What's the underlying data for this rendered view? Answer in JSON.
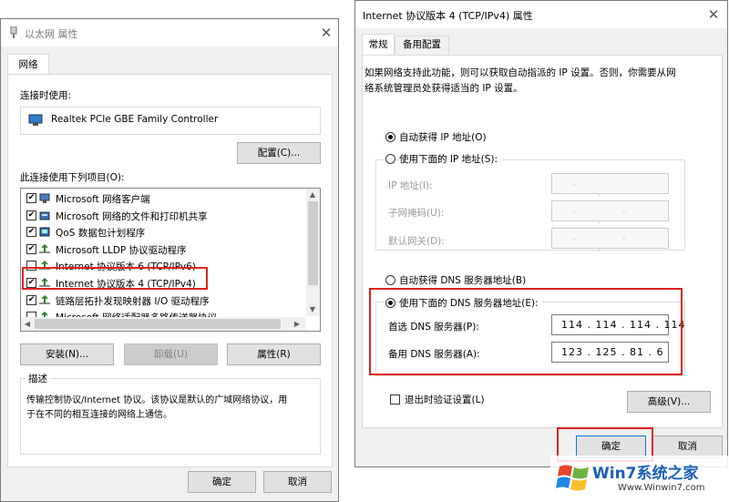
{
  "left_window": {
    "title": "以太网 属性",
    "tab": "网络",
    "connect_using_label": "连接时使用:",
    "adapter_name": "Realtek PCIe GBE Family Controller",
    "configure_button": "配置(C)...",
    "items_label": "此连接使用下列项目(O):",
    "items": [
      {
        "label": "Microsoft 网络客户端",
        "checked": true,
        "icon": "network-client-icon"
      },
      {
        "label": "Microsoft 网络的文件和打印机共享",
        "checked": true,
        "icon": "file-sharing-icon"
      },
      {
        "label": "QoS 数据包计划程序",
        "checked": true,
        "icon": "qos-icon"
      },
      {
        "label": "Microsoft LLDP 协议驱动程序",
        "checked": true,
        "icon": "protocol-icon"
      },
      {
        "label": "Internet 协议版本 6 (TCP/IPv6)",
        "checked": false,
        "icon": "protocol-icon"
      },
      {
        "label": "Internet 协议版本 4 (TCP/IPv4)",
        "checked": true,
        "icon": "protocol-icon"
      },
      {
        "label": "链路层拓扑发现映射器 I/O 驱动程序",
        "checked": true,
        "icon": "protocol-icon"
      },
      {
        "label": "Microsoft 网络适配器多路传送器协议",
        "checked": false,
        "icon": "protocol-icon"
      }
    ],
    "install_button": "安装(N)...",
    "uninstall_button": "卸载(U)",
    "properties_button": "属性(R)",
    "description_label": "描述",
    "description_text_line1": "传输控制协议/Internet 协议。该协议是默认的广域网络协议，用",
    "description_text_line2": "于在不同的相互连接的网络上通信。",
    "ok_button": "确定",
    "cancel_button": "取消"
  },
  "right_window": {
    "title": "Internet 协议版本 4 (TCP/IPv4) 属性",
    "tab_general": "常规",
    "tab_alternate": "备用配置",
    "intro_line1": "如果网络支持此功能，则可以获取自动指派的 IP 设置。否则，你需要从网",
    "intro_line2": "络系统管理员处获得适当的 IP 设置。",
    "auto_ip_label": "自动获得 IP 地址(O)",
    "manual_ip_label": "使用下面的 IP 地址(S):",
    "ip_address_label": "IP 地址(I):",
    "subnet_label": "子网掩码(U):",
    "gateway_label": "默认网关(D):",
    "ip_placeholder": ".       .       .",
    "auto_dns_label": "自动获得 DNS 服务器地址(B)",
    "manual_dns_label": "使用下面的 DNS 服务器地址(E):",
    "preferred_dns_label": "首选 DNS 服务器(P):",
    "preferred_dns_value": "114 . 114 . 114 . 114",
    "alternate_dns_label": "备用 DNS 服务器(A):",
    "alternate_dns_value": "123 . 125 .  81  .  6",
    "validate_label": "退出时验证设置(L)",
    "advanced_button": "高级(V)...",
    "ok_button": "确定",
    "cancel_button": "取消",
    "selected": {
      "auto_ip": true,
      "manual_dns": true
    }
  },
  "watermark": {
    "brand": "Win7系统之家",
    "url": "Www.Winwin7.com"
  },
  "colors": {
    "highlight_red": "#e0211d",
    "accent_blue": "#0078d7"
  }
}
